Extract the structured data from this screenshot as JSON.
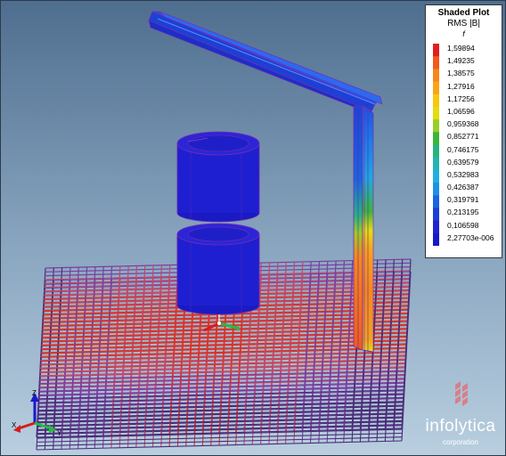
{
  "legend": {
    "title": "Shaded Plot",
    "quantity": "RMS |B|",
    "variable": "f",
    "values": [
      "1,59894",
      "1,49235",
      "1,38575",
      "1,27916",
      "1,17256",
      "1,06596",
      "0,959368",
      "0,852771",
      "0,746175",
      "0,639579",
      "0,532983",
      "0,426387",
      "0,319791",
      "0,213195",
      "0,106598",
      "2,27703e-006"
    ],
    "colors": [
      "#e02020",
      "#f05a1e",
      "#f7871c",
      "#f9a21b",
      "#f6c80e",
      "#e4dc11",
      "#9acd25",
      "#3cb53c",
      "#27b37f",
      "#25b3b2",
      "#21aee0",
      "#1e90e8",
      "#1c64e0",
      "#1d3fd6",
      "#1f24d0",
      "#1a19c8"
    ]
  },
  "axis_triad": {
    "x": "X",
    "y": "Y",
    "z": "Z"
  },
  "logo": {
    "name": "infolytica",
    "sub": "corporation"
  }
}
